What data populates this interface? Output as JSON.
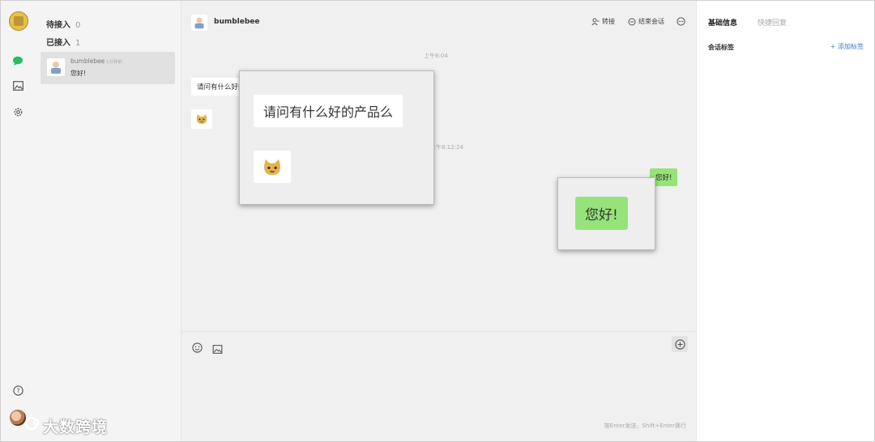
{
  "conversations": {
    "waiting_label": "待接入",
    "waiting_count": "0",
    "accepted_label": "已接入",
    "accepted_count": "1",
    "items": [
      {
        "name": "bumblebee",
        "time": "1分钟前",
        "last_message": "您好!"
      }
    ]
  },
  "chat": {
    "contact_name": "bumblebee",
    "transfer_label": "转接",
    "end_session_label": "结束会话",
    "messages": [
      {
        "type": "time",
        "text": "上午8:04"
      },
      {
        "type": "in",
        "text": "请问有什么好的产品么"
      },
      {
        "type": "in-sticker",
        "icon": "cat-sticker"
      },
      {
        "type": "time",
        "text": "上午8:12:24"
      },
      {
        "type": "out",
        "text": "您好!"
      }
    ],
    "send_hint": "按Enter发送，Shift+Enter换行"
  },
  "zoom": {
    "question_text": "请问有什么好的产品么",
    "reply_text": "您好!"
  },
  "right_panel": {
    "tab_basic": "基础信息",
    "tab_quick_reply": "快捷回复",
    "session_tags_label": "会话标签",
    "add_tag_label": "+ 添加标签"
  },
  "watermark": {
    "text": "大数跨境"
  },
  "colors": {
    "accent_green": "#2bbd5a",
    "bubble_out": "#96e37a",
    "link_blue": "#3a78d8"
  }
}
